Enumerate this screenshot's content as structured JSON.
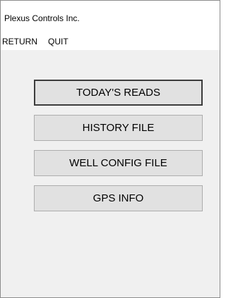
{
  "window": {
    "title": "Plexus Controls Inc."
  },
  "menu": {
    "items": [
      {
        "label": "RETURN"
      },
      {
        "label": "QUIT"
      }
    ]
  },
  "main": {
    "buttons": [
      {
        "label": "TODAY'S READS",
        "focused": true
      },
      {
        "label": "HISTORY FILE",
        "focused": false
      },
      {
        "label": "WELL CONFIG FILE",
        "focused": false
      },
      {
        "label": "GPS INFO",
        "focused": false
      }
    ]
  },
  "colors": {
    "window_bg": "#f0f0f0",
    "title_bg": "#ffffff",
    "button_face": "#e1e1e1",
    "button_border": "#adadad"
  }
}
